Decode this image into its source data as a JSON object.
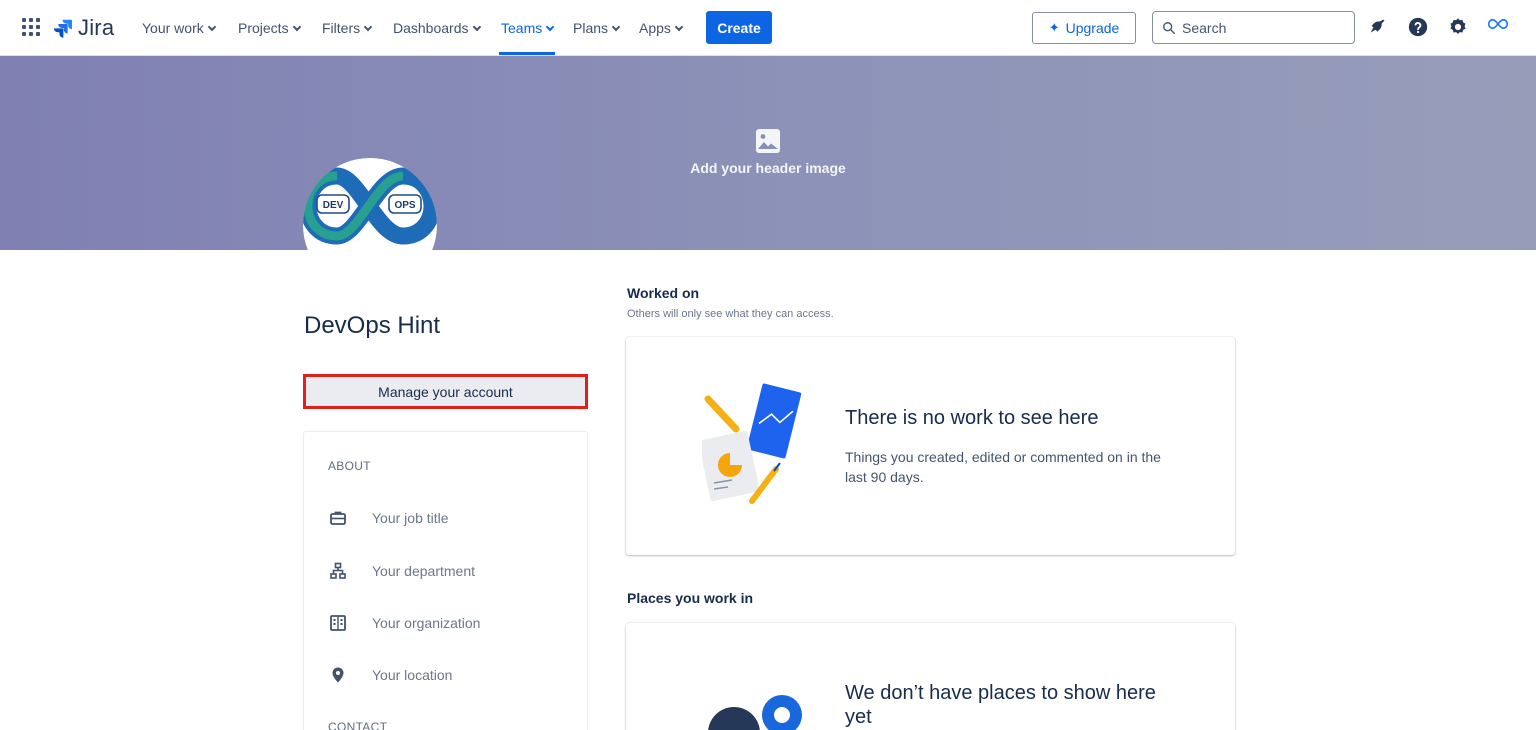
{
  "topnav": {
    "logo_text": "Jira",
    "items": [
      {
        "label": "Your work"
      },
      {
        "label": "Projects"
      },
      {
        "label": "Filters"
      },
      {
        "label": "Dashboards"
      },
      {
        "label": "Teams",
        "active": true
      },
      {
        "label": "Plans"
      },
      {
        "label": "Apps"
      }
    ],
    "create_label": "Create",
    "upgrade_label": "Upgrade",
    "search_placeholder": "Search",
    "icons": [
      "notifications-icon",
      "help-icon",
      "settings-icon",
      "profile-avatar-icon"
    ]
  },
  "header": {
    "add_image_label": "Add your header image"
  },
  "profile": {
    "name": "DevOps Hint",
    "avatar_text": [
      "DEV",
      "OPS"
    ],
    "manage_label": "Manage your account",
    "about": {
      "heading": "ABOUT",
      "rows": [
        {
          "label": "Your job title",
          "icon": "briefcase-icon"
        },
        {
          "label": "Your department",
          "icon": "org-chart-icon"
        },
        {
          "label": "Your organization",
          "icon": "building-icon"
        },
        {
          "label": "Your location",
          "icon": "location-pin-icon"
        }
      ]
    },
    "contact": {
      "heading": "CONTACT"
    }
  },
  "main": {
    "worked_on": {
      "title": "Worked on",
      "subtitle": "Others will only see what they can access.",
      "empty_title": "There is no work to see here",
      "empty_desc": "Things you created, edited or commented on in the last 90 days."
    },
    "places": {
      "title": "Places you work in",
      "empty_title": "We don’t have places to show here yet"
    }
  },
  "colors": {
    "brand_blue": "#0c66e4",
    "banner": "#8a8fb8",
    "highlight_red": "#e0201b"
  }
}
